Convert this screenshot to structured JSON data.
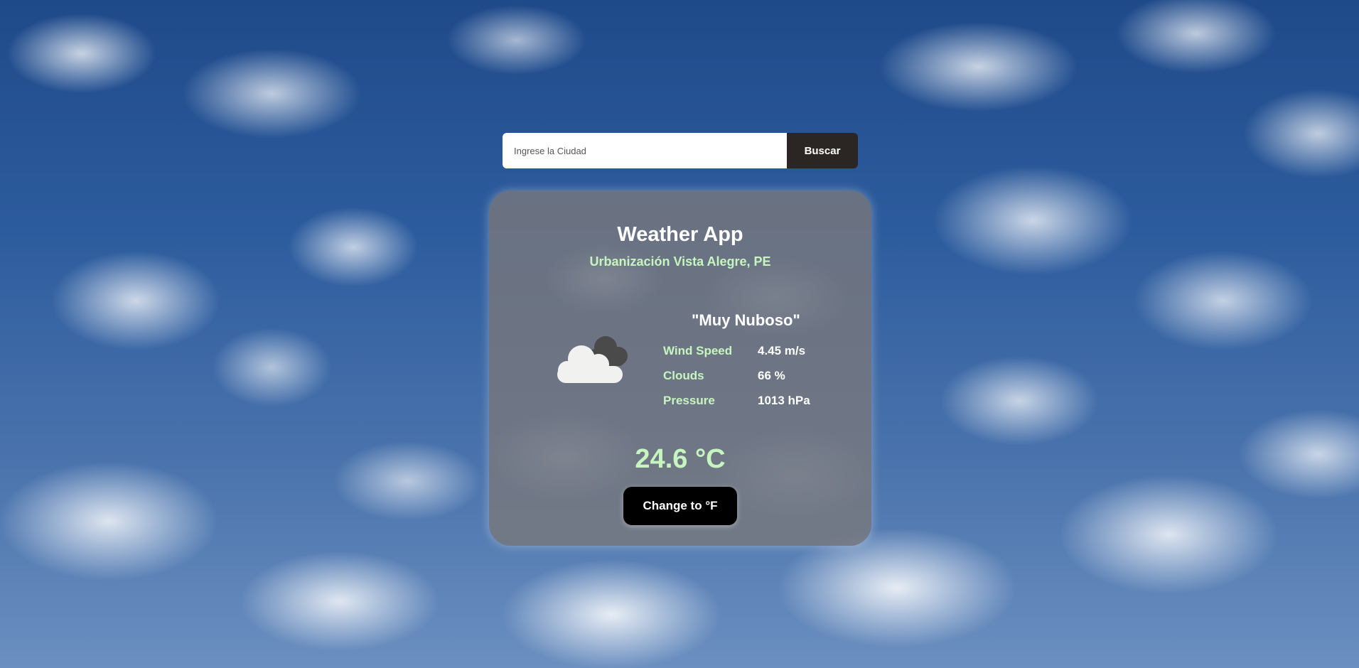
{
  "search": {
    "placeholder": "Ingrese la Ciudad",
    "value": "",
    "button_label": "Buscar"
  },
  "card": {
    "title": "Weather App",
    "location": "Urbanización Vista Alegre, PE",
    "description": "\"Muy Nuboso\"",
    "icon": "cloudy-icon",
    "stats": [
      {
        "label": "Wind Speed",
        "value": "4.45 m/s"
      },
      {
        "label": "Clouds",
        "value": "66 %"
      },
      {
        "label": "Pressure",
        "value": "1013 hPa"
      }
    ],
    "temperature": "24.6 °C",
    "unit_button_label": "Change to °F"
  },
  "colors": {
    "accent_green": "#c6f5c0",
    "card_bg": "#78787d",
    "button_dark": "#2b2624"
  }
}
